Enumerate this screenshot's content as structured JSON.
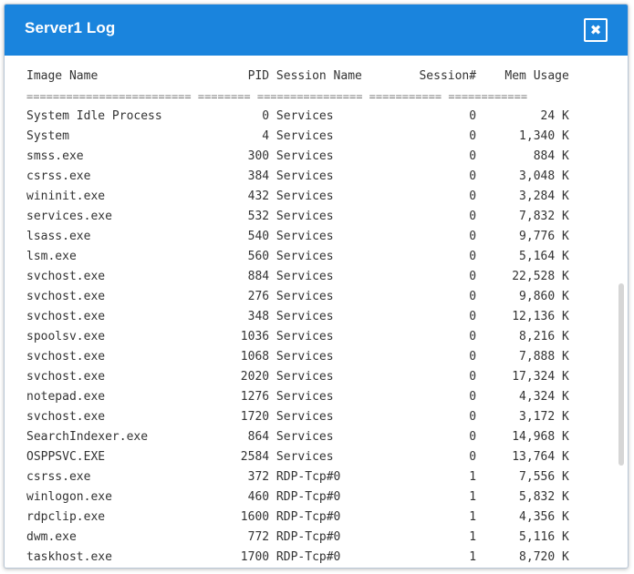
{
  "window": {
    "title": "Server1 Log",
    "close_icon": "close-icon",
    "accent_color": "#1a84dd"
  },
  "log": {
    "header": "Image Name                     PID Session Name        Session#    Mem Usage",
    "separator": "========================= ======== ================ =========== ============",
    "lines": [
      "System Idle Process              0 Services                   0         24 K",
      "System                           4 Services                   0      1,340 K",
      "smss.exe                       300 Services                   0        884 K",
      "csrss.exe                      384 Services                   0      3,048 K",
      "wininit.exe                    432 Services                   0      3,284 K",
      "services.exe                   532 Services                   0      7,832 K",
      "lsass.exe                      540 Services                   0      9,776 K",
      "lsm.exe                        560 Services                   0      5,164 K",
      "svchost.exe                    884 Services                   0     22,528 K",
      "svchost.exe                    276 Services                   0      9,860 K",
      "svchost.exe                    348 Services                   0     12,136 K",
      "spoolsv.exe                   1036 Services                   0      8,216 K",
      "svchost.exe                   1068 Services                   0      7,888 K",
      "svchost.exe                   2020 Services                   0     17,324 K",
      "notepad.exe                   1276 Services                   0      4,324 K",
      "svchost.exe                   1720 Services                   0      3,172 K",
      "SearchIndexer.exe              864 Services                   0     14,968 K",
      "OSPPSVC.EXE                   2584 Services                   0     13,764 K",
      "csrss.exe                      372 RDP-Tcp#0                  1      7,556 K",
      "winlogon.exe                   460 RDP-Tcp#0                  1      5,832 K",
      "rdpclip.exe                   1600 RDP-Tcp#0                  1      4,356 K",
      "dwm.exe                        772 RDP-Tcp#0                  1      5,116 K",
      "taskhost.exe                  1700 RDP-Tcp#0                  1      8,720 K"
    ]
  }
}
